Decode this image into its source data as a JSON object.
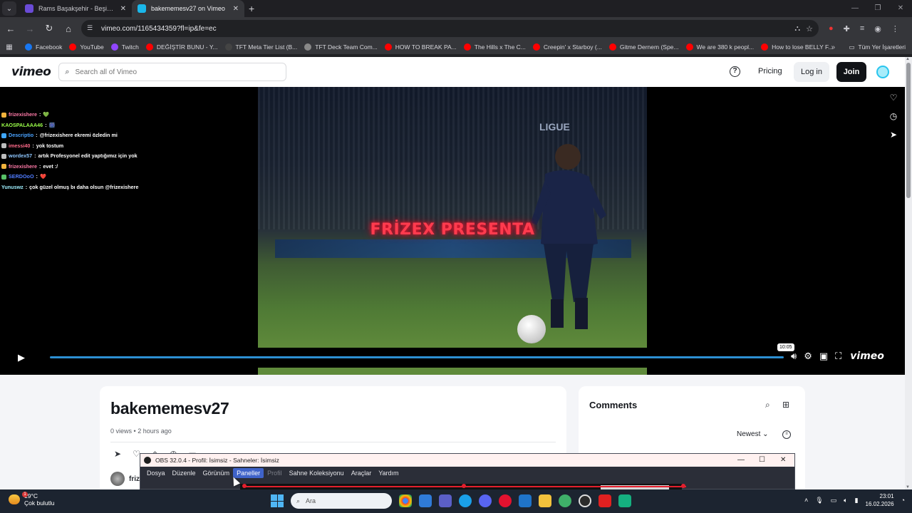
{
  "browser": {
    "tabs": [
      {
        "title": "Rams Başakşehir - Beşiktaş Ma",
        "favicon_color": "#6a4bd6",
        "active": false
      },
      {
        "title": "bakememesv27 on Vimeo",
        "favicon_color": "#1ab7ea",
        "active": true
      }
    ],
    "new_tab_label": "+",
    "url": "vimeo.com/1165434359?fl=ip&fe=ec",
    "bookmarks": [
      {
        "label": "Facebook",
        "color": "#1877f2"
      },
      {
        "label": "YouTube",
        "color": "#ff0000"
      },
      {
        "label": "Twitch",
        "color": "#9146ff"
      },
      {
        "label": "DEĞİŞTİR BUNU - Y...",
        "color": "#ff0000"
      },
      {
        "label": "TFT Meta Tier List (B...",
        "color": "#444444"
      },
      {
        "label": "TFT Deck Team Com...",
        "color": "#888888"
      },
      {
        "label": "HOW TO BREAK PA...",
        "color": "#ff0000"
      },
      {
        "label": "The Hills x The C...",
        "color": "#ff0000"
      },
      {
        "label": "Creepin' x Starboy (...",
        "color": "#ff0000"
      },
      {
        "label": "Gitme Dernem (Spe...",
        "color": "#ff0000"
      },
      {
        "label": "We are 380 k peopl...",
        "color": "#ff0000"
      },
      {
        "label": "How to lose BELLY F...",
        "color": "#ff0000"
      }
    ],
    "all_bookmarks_label": "Tüm Yer İşaretleri"
  },
  "vimeo": {
    "logo": "vimeo",
    "search_placeholder": "Search all of Vimeo",
    "help_label": "?",
    "pricing_label": "Pricing",
    "login_label": "Log in",
    "join_label": "Join",
    "player": {
      "overlay_text": "FRİZEX PRESENTA",
      "stadium_sign": "LIGUE",
      "duration": "10:05",
      "progress_played_fraction": 0.0,
      "watermark": "vimeo",
      "chat": [
        {
          "user": "frizexishere",
          "user_color": "#ff7aa8",
          "message": "💚",
          "badge": "#f2b33d"
        },
        {
          "user": "KAOSPALAAA46",
          "user_color": "#9cff4a",
          "message": "🎆",
          "badge": ""
        },
        {
          "user": "Descriptio",
          "user_color": "#4aa3ff",
          "message": "@frizexishere ekremi özledin mi",
          "badge": "#3fa7ff"
        },
        {
          "user": "imessi40",
          "user_color": "#ff6a8a",
          "message": "yok tostum",
          "badge": "#bdbdbd"
        },
        {
          "user": "wordex57",
          "user_color": "#8ec7ff",
          "message": "artık Profesyonel edit yaptığımız için yok",
          "badge": "#bdbdbd"
        },
        {
          "user": "frizexishere",
          "user_color": "#ff7aa8",
          "message": "evet :/",
          "badge": "#f2b33d"
        },
        {
          "user": "SERDOoO",
          "user_color": "#4f7cff",
          "message": "❤️",
          "badge": "#57c167"
        },
        {
          "user": "Yunuswz",
          "user_color": "#9ff0ff",
          "message": "çok güzel olmuş bı daha olsun @frizexishere",
          "badge": ""
        }
      ]
    },
    "video_title": "bakememesv27",
    "views": "0 views",
    "uploaded": "2 hours ago",
    "owner_name": "friz",
    "comments": {
      "title": "Comments",
      "sort_label": "Newest"
    }
  },
  "obs": {
    "title": "OBS 32.0.4 - Profil: İsimsiz - Sahneler: İsimsiz",
    "menu": [
      "Dosya",
      "Düzenle",
      "Görünüm",
      "Paneller",
      "Profil",
      "Sahne Koleksiyonu",
      "Araçlar",
      "Yardım"
    ],
    "selected_menu": "Paneller",
    "disabled_menu": "Profil"
  },
  "taskbar": {
    "temperature": "19°C",
    "weather_desc": "Çok bulutlu",
    "weather_alert": "1",
    "search_placeholder": "Ara",
    "time": "23:01",
    "date": "16.02.2026"
  }
}
